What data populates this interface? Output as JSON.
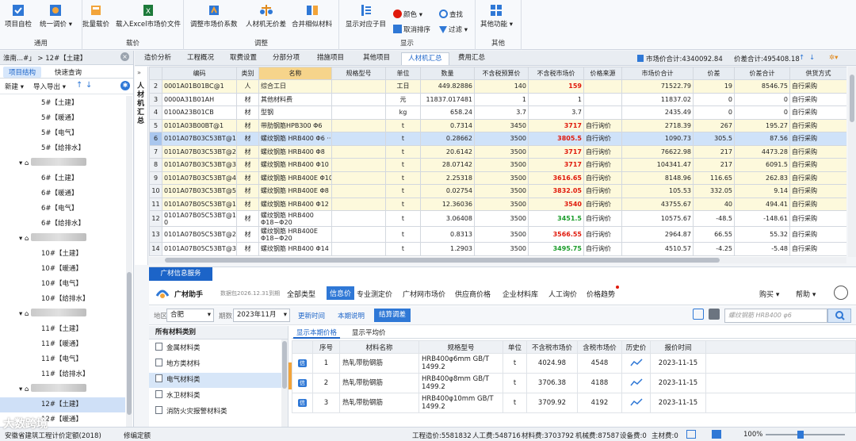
{
  "colors": {
    "accent": "#1c64c8",
    "price_red": "#e0190b",
    "price_green": "#1a9c2a",
    "highlight_row": "#cfe2f9",
    "name_header": "#f6d48b"
  },
  "ribbon": {
    "groups": [
      {
        "label": "通用",
        "buttons": [
          "项目自检",
          "统一调价 ▾"
        ]
      },
      {
        "label": "载价",
        "buttons": [
          "批量载价",
          "载入Excel市场价文件"
        ]
      },
      {
        "label": "调整",
        "buttons": [
          "调整市场价系数",
          "人材机无价差",
          "合并相似材料"
        ]
      },
      {
        "label": "显示",
        "buttons": [
          "显示对应子目"
        ],
        "small": [
          "颜色 ▾",
          "查找",
          "取消排序",
          "过滤 ▾"
        ]
      },
      {
        "label": "其他",
        "buttons": [
          "其他功能 ▾"
        ]
      }
    ]
  },
  "left": {
    "path": "淮南...#」 > 12#【土建】",
    "tabs": [
      "项目结构",
      "快速查询"
    ],
    "tools": {
      "new": "新建 ▾",
      "import_export": "导入导出 ▾"
    },
    "tree": [
      "5#【土建】",
      "5#【暖通】",
      "5#【电气】",
      "5#【给排水】",
      "6#【土建】",
      "6#【暖通】",
      "6#【电气】",
      "6#【给排水】",
      "10#【土建】",
      "10#【暖通】",
      "10#【电气】",
      "10#【给排水】",
      "11#【土建】",
      "11#【暖通】",
      "11#【电气】",
      "11#【给排水】",
      "12#【土建】",
      "12#【暖通】",
      "12#【电气】"
    ]
  },
  "tabs": [
    "造价分析",
    "工程概况",
    "取费设置",
    "分部分项",
    "措施项目",
    "其他项目",
    "人材机汇总",
    "费用汇总"
  ],
  "tab_info": {
    "market_total": "市场价合计:4340092.84",
    "diff_total": "价差合计:495408.18"
  },
  "side_label": "人材机汇总",
  "grid": {
    "columns": [
      "编码",
      "类别",
      "名称",
      "规格型号",
      "单位",
      "数量",
      "不含税预算价",
      "不含税市场价",
      "价格来源",
      "市场价合计",
      "价差",
      "价差合计",
      "供货方式"
    ],
    "rows": [
      {
        "n": "2",
        "code": "0001A01B01BC@1",
        "type": "人",
        "name": "综合工日",
        "spec": "",
        "unit": "工日",
        "qty": "449.82886",
        "budget": "140",
        "market": "159",
        "mstyle": "red",
        "source": "",
        "mtotal": "71522.79",
        "diff": "19",
        "difftotal": "8546.75",
        "supply": "自行采购",
        "style": "y"
      },
      {
        "n": "3",
        "code": "0000A31B01AH",
        "type": "材",
        "name": "其他材料费",
        "spec": "",
        "unit": "元",
        "qty": "11837.017481",
        "budget": "1",
        "market": "1",
        "mstyle": "",
        "source": "",
        "mtotal": "11837.02",
        "diff": "0",
        "difftotal": "0",
        "supply": "自行采购",
        "style": ""
      },
      {
        "n": "4",
        "code": "0100A23B01CB",
        "type": "材",
        "name": "型钢",
        "spec": "",
        "unit": "kg",
        "qty": "658.24",
        "budget": "3.7",
        "market": "3.7",
        "mstyle": "",
        "source": "",
        "mtotal": "2435.49",
        "diff": "0",
        "difftotal": "0",
        "supply": "自行采购",
        "style": ""
      },
      {
        "n": "5",
        "code": "0101A03B00BT@1",
        "type": "材",
        "name": "带肋钢筋HPB300 Φ6",
        "spec": "",
        "unit": "t",
        "qty": "0.7314",
        "budget": "3450",
        "market": "3717",
        "mstyle": "red",
        "source": "自行询价",
        "mtotal": "2718.39",
        "diff": "267",
        "difftotal": "195.27",
        "supply": "自行采购",
        "style": "y"
      },
      {
        "n": "6",
        "code": "0101A07B03C53BT@1",
        "type": "材",
        "name": "螺纹钢筋 HRB400 Φ6 ···",
        "spec": "",
        "unit": "t",
        "qty": "0.28662",
        "budget": "3500",
        "market": "3805.5",
        "mstyle": "red",
        "source": "自行询价",
        "mtotal": "1090.73",
        "diff": "305.5",
        "difftotal": "87.56",
        "supply": "自行采购",
        "style": "hl"
      },
      {
        "n": "7",
        "code": "0101A07B03C53BT@2",
        "type": "材",
        "name": "螺纹钢筋 HRB400 Φ8",
        "spec": "",
        "unit": "t",
        "qty": "20.6142",
        "budget": "3500",
        "market": "3717",
        "mstyle": "red",
        "source": "自行询价",
        "mtotal": "76622.98",
        "diff": "217",
        "difftotal": "4473.28",
        "supply": "自行采购",
        "style": "y"
      },
      {
        "n": "8",
        "code": "0101A07B03C53BT@3",
        "type": "材",
        "name": "螺纹钢筋 HRB400 Φ10",
        "spec": "",
        "unit": "t",
        "qty": "28.07142",
        "budget": "3500",
        "market": "3717",
        "mstyle": "red",
        "source": "自行询价",
        "mtotal": "104341.47",
        "diff": "217",
        "difftotal": "6091.5",
        "supply": "自行采购",
        "style": "y"
      },
      {
        "n": "9",
        "code": "0101A07B03C53BT@4",
        "type": "材",
        "name": "螺纹钢筋 HRB400E Φ10",
        "spec": "",
        "unit": "t",
        "qty": "2.25318",
        "budget": "3500",
        "market": "3616.65",
        "mstyle": "red",
        "source": "自行询价",
        "mtotal": "8148.96",
        "diff": "116.65",
        "difftotal": "262.83",
        "supply": "自行采购",
        "style": "y"
      },
      {
        "n": "10",
        "code": "0101A07B03C53BT@5",
        "type": "材",
        "name": "螺纹钢筋 HRB400E Φ8",
        "spec": "",
        "unit": "t",
        "qty": "0.02754",
        "budget": "3500",
        "market": "3832.05",
        "mstyle": "red",
        "source": "自行询价",
        "mtotal": "105.53",
        "diff": "332.05",
        "difftotal": "9.14",
        "supply": "自行采购",
        "style": "y"
      },
      {
        "n": "11",
        "code": "0101A07B05C53BT@1",
        "type": "材",
        "name": "螺纹钢筋 HRB400 Φ12",
        "spec": "",
        "unit": "t",
        "qty": "12.36036",
        "budget": "3500",
        "market": "3540",
        "mstyle": "red",
        "source": "自行询价",
        "mtotal": "43755.67",
        "diff": "40",
        "difftotal": "494.41",
        "supply": "自行采购",
        "style": "y"
      },
      {
        "n": "12",
        "code": "0101A07B05C53BT@1 0",
        "type": "材",
        "name": "螺纹钢筋 HRB400 Φ18~Φ20",
        "spec": "",
        "unit": "t",
        "qty": "3.06408",
        "budget": "3500",
        "market": "3451.5",
        "mstyle": "green",
        "source": "自行询价",
        "mtotal": "10575.67",
        "diff": "-48.5",
        "difftotal": "-148.61",
        "supply": "自行采购",
        "style": "tall"
      },
      {
        "n": "13",
        "code": "0101A07B05C53BT@2",
        "type": "材",
        "name": "螺纹钢筋 HRB400E Φ18~Φ20",
        "spec": "",
        "unit": "t",
        "qty": "0.8313",
        "budget": "3500",
        "market": "3566.55",
        "mstyle": "red",
        "source": "自行询价",
        "mtotal": "2964.87",
        "diff": "66.55",
        "difftotal": "55.32",
        "supply": "自行采购",
        "style": "tall"
      },
      {
        "n": "14",
        "code": "0101A07B05C53BT@3",
        "type": "材",
        "name": "螺纹钢筋 HRB400 Φ14",
        "spec": "",
        "unit": "t",
        "qty": "1.2903",
        "budget": "3500",
        "market": "3495.75",
        "mstyle": "green",
        "source": "自行询价",
        "mtotal": "4510.57",
        "diff": "-4.25",
        "difftotal": "-5.48",
        "supply": "自行采购",
        "style": ""
      }
    ]
  },
  "info": {
    "tab": "广材信息服务",
    "brand": "广材助手",
    "data_date": "数据包2026.12.31到期",
    "nav": [
      "全部类型",
      "信息价",
      "专业测定价",
      "广材网市场价",
      "供应商价格",
      "企业材料库",
      "人工询价",
      "价格趋势"
    ],
    "nav_active": "信息价",
    "buy": "购买 ▾",
    "help": "帮助 ▾",
    "filter": {
      "region_label": "地区",
      "region": "合肥",
      "period_label": "期数",
      "period": "2023年11月",
      "update_time": "更新时间",
      "period_desc": "本期说明",
      "settle": "结算调差"
    },
    "search_placeholder": "螺纹钢筋 HRB400 φ6",
    "cat_title": "所有材料类别",
    "categories": [
      "金属材料类",
      "地方类材料",
      "电气材料类",
      "水卫材料类",
      "消防火灾报警材料类"
    ],
    "subtabs": [
      "显示本期价格",
      "显示平均价"
    ],
    "price_columns": [
      "序号",
      "材料名称",
      "规格型号",
      "单位",
      "不含税市场价",
      "含税市场价",
      "历史价",
      "报价时间"
    ],
    "price_rows": [
      {
        "no": "1",
        "name": "热轧带肋钢筋",
        "spec": "HRB400φ6mm GB/T 1499.2",
        "unit": "t",
        "ex": "4024.98",
        "inc": "4548",
        "date": "2023-11-15"
      },
      {
        "no": "2",
        "name": "热轧带肋钢筋",
        "spec": "HRB400φ8mm GB/T 1499.2",
        "unit": "t",
        "ex": "3706.38",
        "inc": "4188",
        "date": "2023-11-15"
      },
      {
        "no": "3",
        "name": "热轧带肋钢筋",
        "spec": "HRB400φ10mm GB/T 1499.2",
        "unit": "t",
        "ex": "3709.92",
        "inc": "4192",
        "date": "2023-11-15"
      }
    ],
    "info_icon": "信"
  },
  "status": {
    "project": "安徽省建筑工程计价定额(2018)",
    "editing": "修编定额",
    "cost": "工程造价:5581832",
    "labor": "人工费:548716",
    "material": "材料费:3703792",
    "machine": "机械费:87587",
    "equipment": "设备费:0",
    "main_material": "主材费:0",
    "zoom": "100%"
  },
  "watermark": "大数跨境"
}
